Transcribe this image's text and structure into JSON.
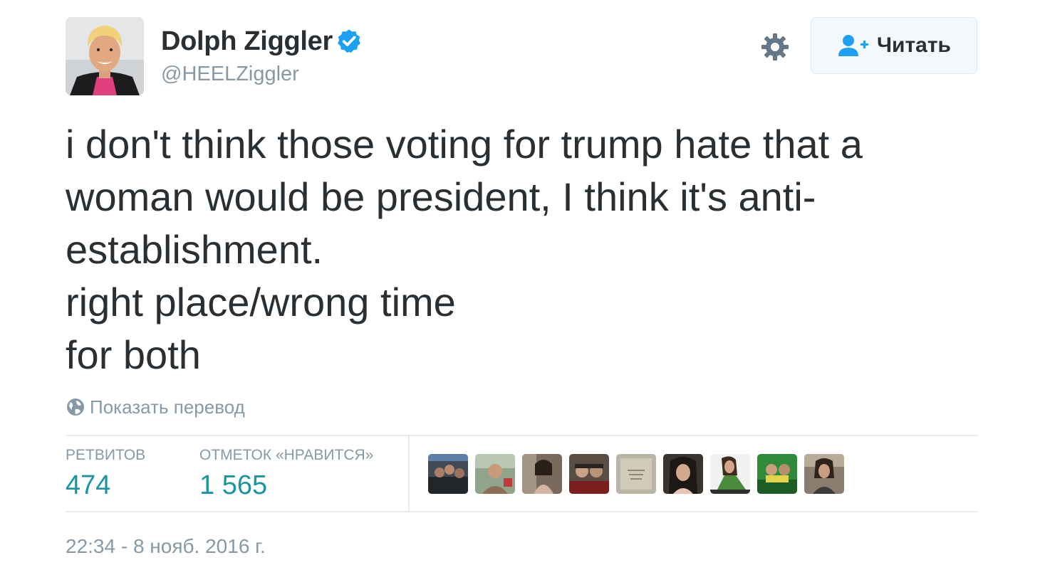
{
  "author": {
    "display_name": "Dolph Ziggler",
    "handle": "@HEELZiggler",
    "avatar_icon": "user-avatar",
    "verified_icon": "verified-badge-icon",
    "verified_color": "#1da1f2"
  },
  "header": {
    "settings_icon": "gear-icon",
    "follow_label": "Читать",
    "follow_icon": "add-user-icon",
    "accent_color": "#1da1f2"
  },
  "tweet": {
    "lines": [
      "i don't think those voting for trump hate that a",
      "woman would be president, I think it's anti-",
      "establishment.",
      "right place/wrong time",
      "for both"
    ],
    "translate_label": "Показать перевод",
    "translate_icon": "globe-icon"
  },
  "stats": {
    "retweets_label": "РЕТВИТОВ",
    "retweets_value": "474",
    "likes_label": "ОТМЕТОК «НРАВИТСЯ»",
    "likes_value": "1 565",
    "value_color": "#1b95a0"
  },
  "likers": [
    {
      "name": "liker-avatar-1"
    },
    {
      "name": "liker-avatar-2"
    },
    {
      "name": "liker-avatar-3"
    },
    {
      "name": "liker-avatar-4"
    },
    {
      "name": "liker-avatar-5"
    },
    {
      "name": "liker-avatar-6"
    },
    {
      "name": "liker-avatar-7"
    },
    {
      "name": "liker-avatar-8"
    },
    {
      "name": "liker-avatar-9"
    }
  ],
  "timestamp": "22:34 - 8 нояб. 2016 г."
}
